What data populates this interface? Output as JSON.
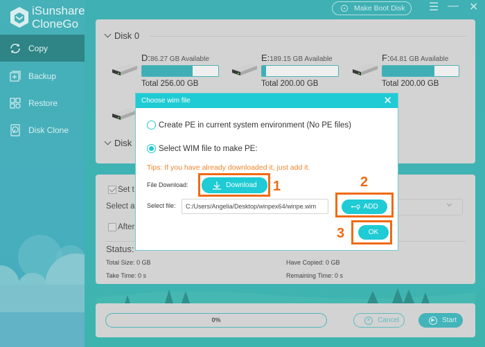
{
  "app": {
    "name_line1": "iSunshare",
    "name_line2": "CloneGo",
    "make_boot_disk": "Make Boot Disk"
  },
  "sidebar": {
    "items": [
      {
        "label": "Copy",
        "icon": "sync-icon",
        "active": true
      },
      {
        "label": "Backup",
        "icon": "backup-icon",
        "active": false
      },
      {
        "label": "Restore",
        "icon": "restore-icon",
        "active": false
      },
      {
        "label": "Disk Clone",
        "icon": "disk-clone-icon",
        "active": false
      }
    ]
  },
  "disks": {
    "disk0_label": "Disk 0",
    "disk1_label": "Disk",
    "drives": [
      {
        "letter": "D:",
        "available": "86.27 GB Available",
        "total": "Total 256.00 GB",
        "used_fraction": 0.66
      },
      {
        "letter": "E:",
        "available": "189.15 GB Available",
        "total": "Total 200.00 GB",
        "used_fraction": 0.05
      },
      {
        "letter": "F:",
        "available": "64.81 GB Available",
        "total": "Total 200.00 GB",
        "used_fraction": 0.68
      }
    ]
  },
  "options": {
    "set_partial": "Set t",
    "select_partial": "Select a",
    "after_partial": "After",
    "status_label": "Status:",
    "total_size": "Total Size: 0 GB",
    "have_copied": "Have Copied: 0 GB",
    "take_time": "Take Time: 0 s",
    "remaining_time": "Remaining Time: 0 s"
  },
  "bottom": {
    "progress_text": "0%",
    "progress_value": 0,
    "cancel": "Cancel",
    "start": "Start"
  },
  "dialog": {
    "title": "Choose wim file",
    "close": "✕",
    "option1": "Create PE in current system environment (No PE files)",
    "option2": "Select WIM file to make PE:",
    "selected_option": 2,
    "tips": "Tips: If you have already downloaded it, just add it.",
    "file_download_label": "File Download:",
    "download_button": "Download",
    "select_file_label": "Select file:",
    "select_file_value": "C:/Users/Angelia/Desktop/winpex64/winpe.wim",
    "add_button": "ADD",
    "ok_button": "OK"
  },
  "annotations": {
    "step1": "1",
    "step2": "2",
    "step3": "3",
    "color": "#f06a12"
  },
  "colors": {
    "accent": "#1fcbd4",
    "sidebar_active": "#2f8485",
    "tips": "#f0842c"
  }
}
